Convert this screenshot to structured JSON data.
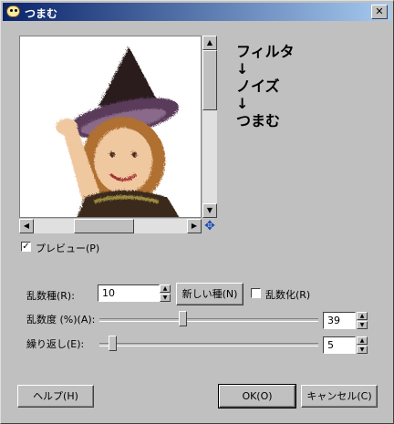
{
  "window": {
    "title": "つまむ",
    "close_glyph": "✕"
  },
  "annotation": {
    "lines": [
      "フィルタ",
      "↓",
      "ノイズ",
      "↓",
      "つまむ"
    ]
  },
  "preview": {
    "label": "プレビュー(P)",
    "checked": true
  },
  "scroll": {
    "up": "▲",
    "down": "▼",
    "left": "◀",
    "right": "▶",
    "nav_glyph": "✥"
  },
  "seed": {
    "label": "乱数種(R):",
    "value": "10",
    "new_seed_label": "新しい種(N)",
    "randomize_label": "乱数化(R)",
    "randomize_checked": false
  },
  "randomization": {
    "label": "乱数度 (%)(A):",
    "value": "39"
  },
  "repeat": {
    "label": "繰り返し(E):",
    "value": "5"
  },
  "buttons": {
    "help": "ヘルプ(H)",
    "ok": "OK(O)",
    "cancel": "キャンセル(C)"
  },
  "icons": [
    "gimp-app-icon",
    "close-icon",
    "scroll-arrow-icons",
    "navigate-icon",
    "checkbox-check-icon"
  ]
}
